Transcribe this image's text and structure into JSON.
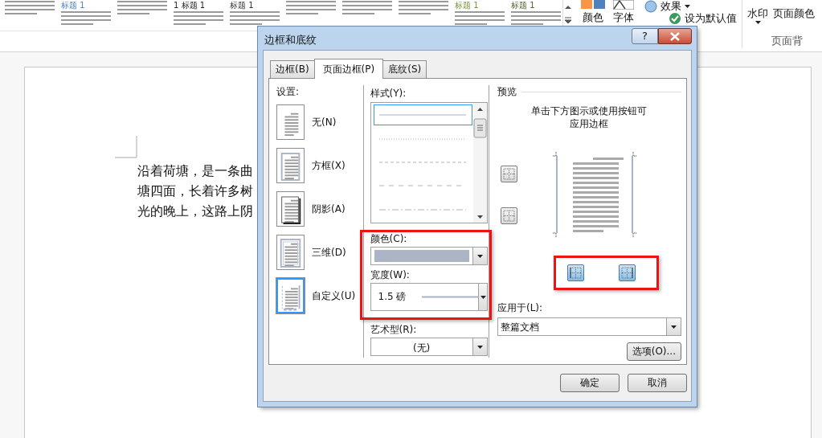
{
  "ribbon": {
    "gallery": [
      {
        "kind": "thumbnail"
      },
      {
        "kind": "thumbnail",
        "title": "标题 1",
        "color": "#4f81bd"
      },
      {
        "kind": "thumbnail"
      },
      {
        "kind": "thumbnail",
        "title": "1 标题 1",
        "color": "#222222"
      },
      {
        "kind": "thumbnail",
        "title": "标题 1",
        "color": "#333333"
      },
      {
        "kind": "thumbnail"
      },
      {
        "kind": "thumbnail"
      },
      {
        "kind": "thumbnail"
      },
      {
        "kind": "thumbnail",
        "title": "标题 1",
        "color": "#77933c"
      },
      {
        "kind": "thumbnail",
        "title": "标题 1",
        "color": "#4f6228"
      }
    ],
    "colors": "颜色",
    "fonts": "字体",
    "effects": "效果",
    "set_default": "设为默认值",
    "watermark": "水印",
    "page_color": "页面颜色",
    "group_label": "页面背"
  },
  "document": {
    "lines": [
      "沿着荷塘，是一条曲",
      "塘四面，长着许多树",
      "光的晚上，这路上阴"
    ]
  },
  "dialog": {
    "title": "边框和底纹",
    "help": "?",
    "tabs": [
      {
        "label": "边框(B)",
        "selected": false
      },
      {
        "label": "页面边框(P)",
        "selected": true
      },
      {
        "label": "底纹(S)",
        "selected": false
      }
    ],
    "settings": {
      "label": "设置:",
      "items": [
        {
          "kind": "none",
          "label": "无(N)",
          "selected": false
        },
        {
          "kind": "box",
          "label": "方框(X)",
          "selected": false
        },
        {
          "kind": "shadow",
          "label": "阴影(A)",
          "selected": false
        },
        {
          "kind": "three-d",
          "label": "三维(D)",
          "selected": false
        },
        {
          "kind": "custom",
          "label": "自定义(U)",
          "selected": true
        }
      ]
    },
    "style": {
      "label": "样式(Y):",
      "lines": [
        {
          "kind": "solid",
          "selected": true
        },
        {
          "kind": "dotted",
          "selected": false
        },
        {
          "kind": "dashed",
          "selected": false
        },
        {
          "kind": "long-dash",
          "selected": false
        },
        {
          "kind": "dash-dot",
          "selected": false
        }
      ]
    },
    "color_width_highlighted": true,
    "color": {
      "label": "颜色(C):",
      "color": "#abb5c6"
    },
    "width": {
      "label": "宽度(W):",
      "value": "1.5 磅"
    },
    "art": {
      "label": "艺术型(R):",
      "value": "(无)"
    },
    "preview": {
      "label": "预览",
      "hint": "单击下方图示或使用按钮可应用边框",
      "buttons_highlighted": true,
      "border_buttons": [
        {
          "kind": "top",
          "on": false
        },
        {
          "kind": "bottom",
          "on": false
        },
        {
          "kind": "left",
          "on": true
        },
        {
          "kind": "right",
          "on": true
        }
      ]
    },
    "apply_to": {
      "label": "应用于(L):",
      "value": "整篇文档"
    },
    "options_button": "选项(O)...",
    "ok_button": "确定",
    "cancel_button": "取消"
  }
}
